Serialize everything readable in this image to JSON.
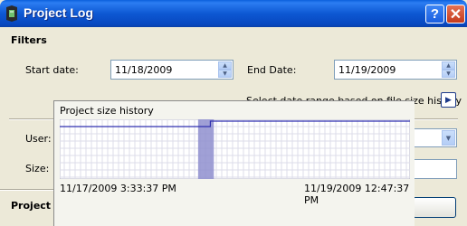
{
  "window": {
    "title": "Project Log",
    "help_label": "?",
    "close_label": "✕"
  },
  "filters": {
    "section_title": "Filters",
    "start_label": "Start date:",
    "start_value": "11/18/2009",
    "end_label": "End Date:",
    "end_value": "11/19/2009",
    "range_label": "Select date range based on file size history",
    "user_label": "User:",
    "size_label": "Size:"
  },
  "project_section": {
    "label": "Project l"
  },
  "history_popup": {
    "title": "Project size history",
    "start_timestamp": "11/17/2009 3:33:37 PM",
    "end_timestamp": "11/19/2009 12:47:37 PM",
    "selection_start_fraction": 0.395,
    "selection_end_fraction": 0.44,
    "step_fraction": 0.43,
    "line_color": "#3030b0",
    "selection_color": "#8f8fcf"
  }
}
